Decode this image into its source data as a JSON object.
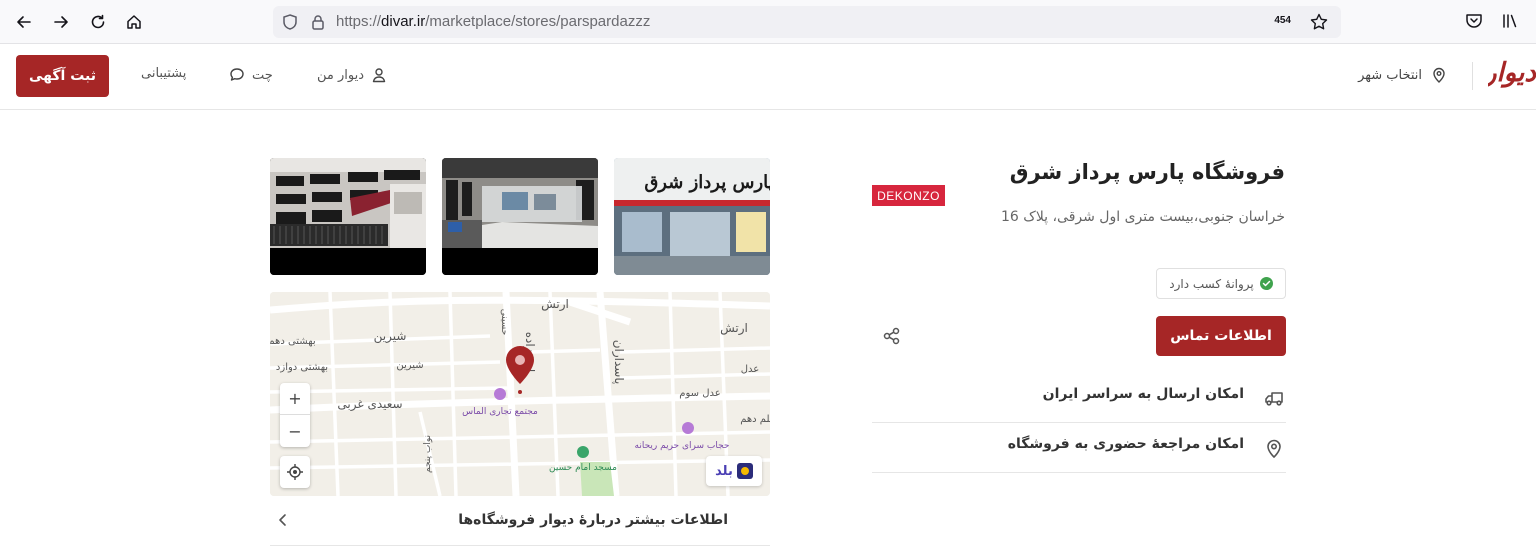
{
  "browser": {
    "url_prefix": "https://",
    "url_host": "divar.ir",
    "url_path": "/marketplace/stores/parspardazzz",
    "zoom_badge": "454"
  },
  "header": {
    "post_button": "ثبت آگهی",
    "support": "پشتیبانی",
    "chat": "چت",
    "my_divar": "دیوار من",
    "city": "انتخاب شهر",
    "logo": "دیوار"
  },
  "store": {
    "title": "فروشگاه پارس پرداز شرق",
    "address": "خراسان جنوبی،بیست متری اول شرقی، پلاک 16",
    "logo_text": "DEKONZO",
    "license": "پروانهٔ کسب دارد",
    "contact_button": "اطلاعات تماس",
    "features": [
      {
        "label": "امکان ارسال به سراسر ایران",
        "icon": "truck-icon"
      },
      {
        "label": "امکان مراجعهٔ حضوری به فروشگاه",
        "icon": "location-pin-icon"
      }
    ],
    "sign_text": "پارس پرداز شرق"
  },
  "map": {
    "labels": {
      "arash1": "ارتش",
      "arash2": "ارتش",
      "shirin": "شیرین",
      "shirin2": "شیرین",
      "beheshti": "بهشتی دهم",
      "beheshti2": "بهشتی دوازد",
      "saeidi": "سعیدی غربی",
      "mall": "مجتمع تجاری الماس",
      "hijab": "حجاب سرای حریم ریحانه",
      "mosque": "مسجد امام حسین",
      "adl": "عدل سوم",
      "adl2": "عدل",
      "asadzadeh": "اسدزاده",
      "pasdaran": "پاسداران",
      "hosseini": "حسینی",
      "navvab": "نواب پنجم",
      "elm": "علم دهم"
    },
    "zoom_in": "+",
    "zoom_out": "−",
    "brand": "بلد"
  },
  "more_info": "اطلاعات بیشتر دربارهٔ دیوار فروشگاه‌ها",
  "colors": {
    "brand_red": "#a62626",
    "check_green": "#3fa34d"
  }
}
